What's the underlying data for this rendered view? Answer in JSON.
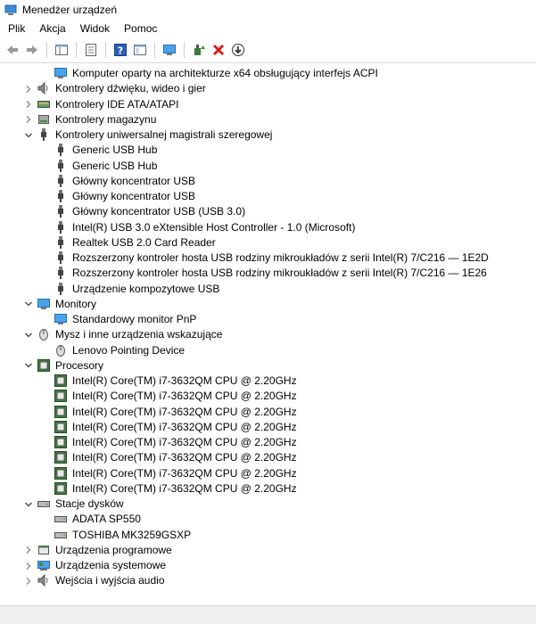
{
  "window": {
    "title": "Menedżer urządzeń"
  },
  "menu": [
    "Plik",
    "Akcja",
    "Widok",
    "Pomoc"
  ],
  "toolbar": [
    "back",
    "forward",
    "properties-view",
    "show-hidden",
    "help",
    "console",
    "monitor-scan",
    "update-driver",
    "disable",
    "uninstall"
  ],
  "tree": [
    {
      "level": 1,
      "expander": "none",
      "icon": "monitor",
      "label": "Komputer oparty na architekturze x64 obsługujący interfejs ACPI"
    },
    {
      "level": 0,
      "expander": "collapsed",
      "icon": "speaker",
      "label": "Kontrolery dźwięku, wideo i gier"
    },
    {
      "level": 0,
      "expander": "collapsed",
      "icon": "ide",
      "label": "Kontrolery IDE ATA/ATAPI"
    },
    {
      "level": 0,
      "expander": "collapsed",
      "icon": "storage",
      "label": "Kontrolery magazynu"
    },
    {
      "level": 0,
      "expander": "expanded",
      "icon": "usb",
      "label": "Kontrolery uniwersalnej magistrali szeregowej"
    },
    {
      "level": 1,
      "expander": "none",
      "icon": "usb",
      "label": "Generic USB Hub"
    },
    {
      "level": 1,
      "expander": "none",
      "icon": "usb",
      "label": "Generic USB Hub"
    },
    {
      "level": 1,
      "expander": "none",
      "icon": "usb",
      "label": "Główny koncentrator USB"
    },
    {
      "level": 1,
      "expander": "none",
      "icon": "usb",
      "label": "Główny koncentrator USB"
    },
    {
      "level": 1,
      "expander": "none",
      "icon": "usb",
      "label": "Główny koncentrator USB (USB 3.0)"
    },
    {
      "level": 1,
      "expander": "none",
      "icon": "usb",
      "label": "Intel(R) USB 3.0 eXtensible Host Controller - 1.0 (Microsoft)"
    },
    {
      "level": 1,
      "expander": "none",
      "icon": "usb",
      "label": "Realtek USB 2.0 Card Reader"
    },
    {
      "level": 1,
      "expander": "none",
      "icon": "usb",
      "label": "Rozszerzony kontroler hosta USB rodziny mikroukładów z serii Intel(R) 7/C216 — 1E2D"
    },
    {
      "level": 1,
      "expander": "none",
      "icon": "usb",
      "label": "Rozszerzony kontroler hosta USB rodziny mikroukładów z serii Intel(R) 7/C216 — 1E26"
    },
    {
      "level": 1,
      "expander": "none",
      "icon": "usb",
      "label": "Urządzenie kompozytowe USB"
    },
    {
      "level": 0,
      "expander": "expanded",
      "icon": "monitor",
      "label": "Monitory"
    },
    {
      "level": 1,
      "expander": "none",
      "icon": "monitor",
      "label": "Standardowy monitor PnP"
    },
    {
      "level": 0,
      "expander": "expanded",
      "icon": "mouse",
      "label": "Mysz i inne urządzenia wskazujące"
    },
    {
      "level": 1,
      "expander": "none",
      "icon": "mouse",
      "label": "Lenovo Pointing Device"
    },
    {
      "level": 0,
      "expander": "expanded",
      "icon": "cpu",
      "label": "Procesory"
    },
    {
      "level": 1,
      "expander": "none",
      "icon": "cpu",
      "label": "Intel(R) Core(TM) i7-3632QM CPU @ 2.20GHz"
    },
    {
      "level": 1,
      "expander": "none",
      "icon": "cpu",
      "label": "Intel(R) Core(TM) i7-3632QM CPU @ 2.20GHz"
    },
    {
      "level": 1,
      "expander": "none",
      "icon": "cpu",
      "label": "Intel(R) Core(TM) i7-3632QM CPU @ 2.20GHz"
    },
    {
      "level": 1,
      "expander": "none",
      "icon": "cpu",
      "label": "Intel(R) Core(TM) i7-3632QM CPU @ 2.20GHz"
    },
    {
      "level": 1,
      "expander": "none",
      "icon": "cpu",
      "label": "Intel(R) Core(TM) i7-3632QM CPU @ 2.20GHz"
    },
    {
      "level": 1,
      "expander": "none",
      "icon": "cpu",
      "label": "Intel(R) Core(TM) i7-3632QM CPU @ 2.20GHz"
    },
    {
      "level": 1,
      "expander": "none",
      "icon": "cpu",
      "label": "Intel(R) Core(TM) i7-3632QM CPU @ 2.20GHz"
    },
    {
      "level": 1,
      "expander": "none",
      "icon": "cpu",
      "label": "Intel(R) Core(TM) i7-3632QM CPU @ 2.20GHz"
    },
    {
      "level": 0,
      "expander": "expanded",
      "icon": "disk",
      "label": "Stacje dysków"
    },
    {
      "level": 1,
      "expander": "none",
      "icon": "disk",
      "label": "ADATA SP550"
    },
    {
      "level": 1,
      "expander": "none",
      "icon": "disk",
      "label": "TOSHIBA MK3259GSXP"
    },
    {
      "level": 0,
      "expander": "collapsed",
      "icon": "software",
      "label": "Urządzenia programowe"
    },
    {
      "level": 0,
      "expander": "collapsed",
      "icon": "system",
      "label": "Urządzenia systemowe"
    },
    {
      "level": 0,
      "expander": "collapsed",
      "icon": "speaker",
      "label": "Wejścia i wyjścia audio"
    }
  ]
}
